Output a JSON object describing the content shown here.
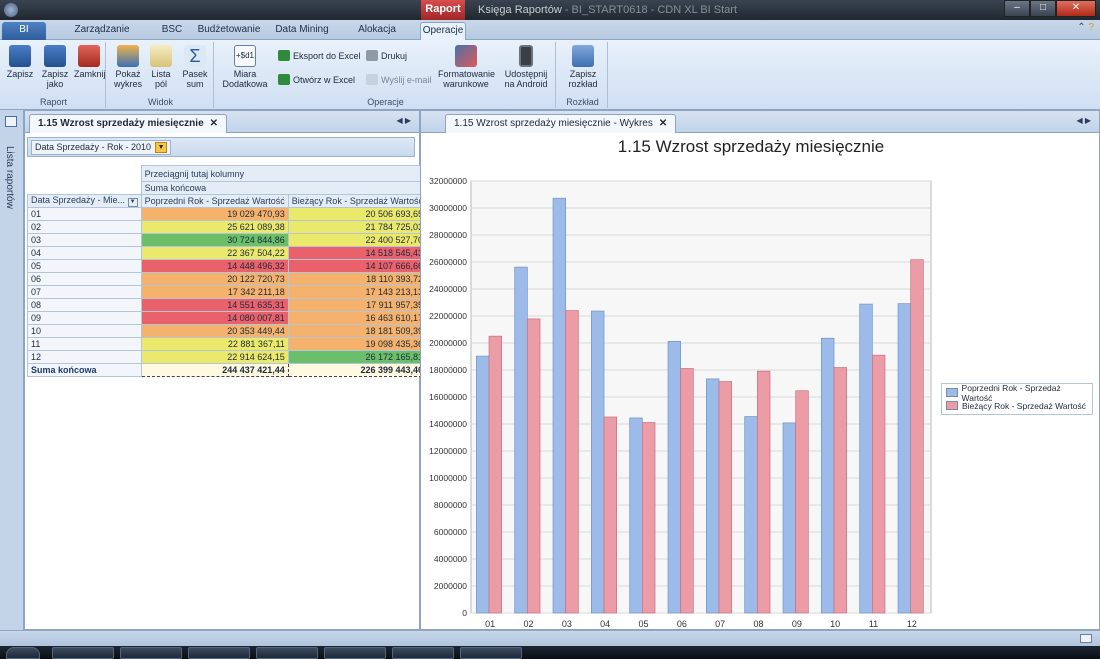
{
  "window": {
    "context_tab": "Raport",
    "title": "Księga Raportów",
    "title_suffix": " - BI_START0618 - CDN XL BI Start"
  },
  "tabs": [
    "BI",
    "Zarządzanie raportami",
    "BSC",
    "Budżetowanie",
    "Data Mining",
    "Alokacja kosztów",
    "Operacje"
  ],
  "ribbon": {
    "raport": {
      "label": "Raport",
      "save": "Zapisz",
      "save_as": "Zapisz jako",
      "close": "Zamknij"
    },
    "widok": {
      "label": "Widok",
      "show_chart": "Pokaż wykres",
      "field_list": "Lista pól",
      "sum_bar": "Pasek sum"
    },
    "operacje": {
      "label": "Operacje",
      "measure": "Miara Dodatkowa",
      "export_excel": "Eksport do Excel",
      "open_excel": "Otwórz w Excel",
      "print": "Drukuj",
      "send_email": "Wyślij e-mail",
      "cond_format": "Formatowanie warunkowe",
      "share_android": "Udostępnij na Android"
    },
    "rozklad": {
      "label": "Rozkład",
      "save_layout": "Zapisz rozkład"
    }
  },
  "sidebar_label": "Lista raportów",
  "left_panel": {
    "tab_title": "1.15 Wzrost sprzedaży miesięcznie",
    "filter": "Data Sprzedaży - Rok - 2010",
    "drag_hint": "Przeciągnij tutaj kolumny",
    "grand_total_header": "Suma końcowa",
    "row_field": "Data Sprzedaży - Mie...",
    "col1": "Poprzedni Rok - Sprzedaż Wartość",
    "col2": "Bieżący Rok - Sprzedaż Wartość",
    "rows": [
      {
        "m": "01",
        "v1": "19 029 470,93",
        "v2": "20 506 693,65"
      },
      {
        "m": "02",
        "v1": "25 621 089,38",
        "v2": "21 784 725,03"
      },
      {
        "m": "03",
        "v1": "30 724 844,86",
        "v2": "22 400 527,70"
      },
      {
        "m": "04",
        "v1": "22 367 504,22",
        "v2": "14 518 545,43"
      },
      {
        "m": "05",
        "v1": "14 448 496,32",
        "v2": "14 107 666,66"
      },
      {
        "m": "06",
        "v1": "20 122 720,73",
        "v2": "18 110 393,72"
      },
      {
        "m": "07",
        "v1": "17 342 211,18",
        "v2": "17 143 213,13"
      },
      {
        "m": "08",
        "v1": "14 551 635,31",
        "v2": "17 911 957,35"
      },
      {
        "m": "09",
        "v1": "14 080 007,81",
        "v2": "16 463 610,17"
      },
      {
        "m": "10",
        "v1": "20 353 449,44",
        "v2": "18 181 509,39"
      },
      {
        "m": "11",
        "v1": "22 881 367,11",
        "v2": "19 098 435,36"
      },
      {
        "m": "12",
        "v1": "22 914 624,15",
        "v2": "26 172 165,81"
      }
    ],
    "total_label": "Suma końcowa",
    "total_v1": "244 437 421,44",
    "total_v2": "226 399 443,40"
  },
  "right_panel": {
    "tab_title": "1.15 Wzrost sprzedaży miesięcznie - Wykres"
  },
  "colors": {
    "series1": "#9dbbe8",
    "series2": "#ec9ca6",
    "heat_red": "#e9616b",
    "heat_orange": "#f4b26c",
    "heat_yellow": "#ebe96c",
    "heat_green": "#6bbf6a"
  },
  "chart_data": {
    "type": "bar",
    "title": "1.15 Wzrost sprzedaży miesięcznie",
    "categories": [
      "01",
      "02",
      "03",
      "04",
      "05",
      "06",
      "07",
      "08",
      "09",
      "10",
      "11",
      "12"
    ],
    "series": [
      {
        "name": "Poprzedni Rok - Sprzedaż Wartość",
        "values": [
          19029470.93,
          25621089.38,
          30724844.86,
          22367504.22,
          14448496.32,
          20122720.73,
          17342211.18,
          14551635.31,
          14080007.81,
          20353449.44,
          22881367.11,
          22914624.15
        ]
      },
      {
        "name": "Bieżący Rok - Sprzedaż Wartość",
        "values": [
          20506693.65,
          21784725.03,
          22400527.7,
          14518545.43,
          14107666.66,
          18110393.72,
          17143213.13,
          17911957.35,
          16463610.17,
          18181509.39,
          19098435.36,
          26172165.81
        ]
      }
    ],
    "ylim": [
      0,
      32000000
    ],
    "y_ticks": [
      "0",
      "2000000",
      "4000000",
      "6000000",
      "8000000",
      "10000000",
      "12000000",
      "14000000",
      "16000000",
      "18000000",
      "20000000",
      "22000000",
      "24000000",
      "26000000",
      "28000000",
      "30000000",
      "32000000"
    ],
    "grid": true,
    "legend_position": "right"
  }
}
